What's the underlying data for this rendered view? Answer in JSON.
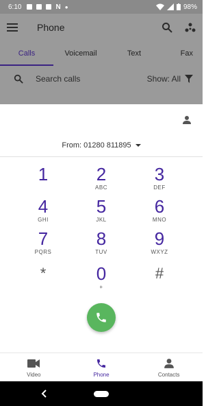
{
  "status_bar": {
    "time": "6:10",
    "battery": "98%"
  },
  "app_bar": {
    "title": "Phone"
  },
  "tabs": [
    {
      "label": "Calls",
      "active": true
    },
    {
      "label": "Voicemail",
      "active": false
    },
    {
      "label": "Text",
      "active": false
    },
    {
      "label": "Fax",
      "active": false
    }
  ],
  "search": {
    "placeholder": "Search calls",
    "show_label": "Show: All"
  },
  "dialpad": {
    "from_label": "From: 01280 811895",
    "keys": [
      {
        "digit": "1",
        "letters": ""
      },
      {
        "digit": "2",
        "letters": "ABC"
      },
      {
        "digit": "3",
        "letters": "DEF"
      },
      {
        "digit": "4",
        "letters": "GHI"
      },
      {
        "digit": "5",
        "letters": "JKL"
      },
      {
        "digit": "6",
        "letters": "MNO"
      },
      {
        "digit": "7",
        "letters": "PQRS"
      },
      {
        "digit": "8",
        "letters": "TUV"
      },
      {
        "digit": "9",
        "letters": "WXYZ"
      },
      {
        "digit": "*",
        "letters": ""
      },
      {
        "digit": "0",
        "letters": "+"
      },
      {
        "digit": "#",
        "letters": ""
      }
    ]
  },
  "bottom_nav": [
    {
      "label": "Video",
      "icon": "video-icon",
      "active": false
    },
    {
      "label": "Phone",
      "icon": "phone-icon",
      "active": true
    },
    {
      "label": "Contacts",
      "icon": "person-icon",
      "active": false
    }
  ],
  "colors": {
    "accent": "#4527a0",
    "call_button": "#59b65e",
    "scrim": "#9a9a9a"
  }
}
